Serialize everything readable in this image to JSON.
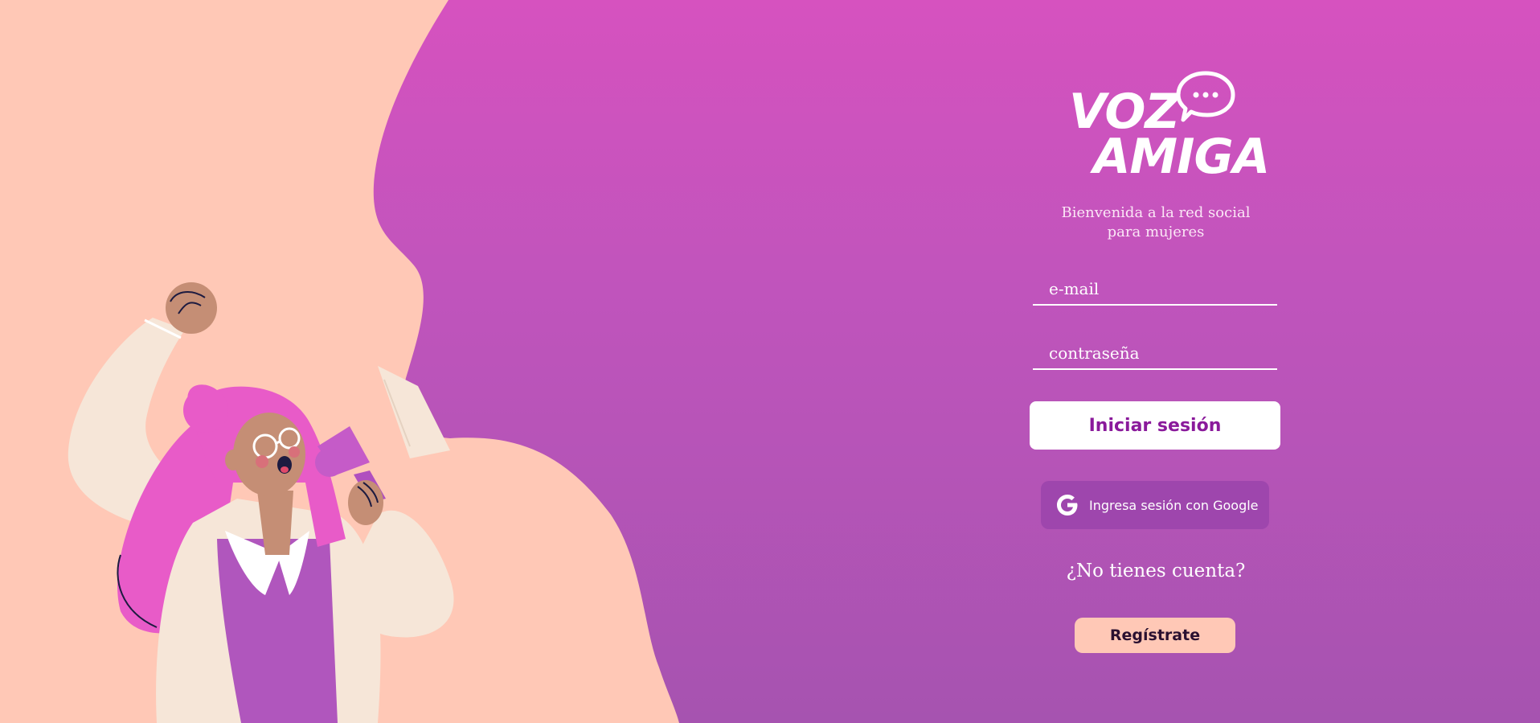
{
  "brand": {
    "logo_line1": "VOZ",
    "logo_line2": "AMIGA",
    "tagline_line1": "Bienvenida a la red social",
    "tagline_line2": "para mujeres"
  },
  "login_form": {
    "email_placeholder": "e-mail",
    "password_placeholder": "contraseña",
    "login_button": "Iniciar sesión",
    "google_button": "Ingresa sesión con Google",
    "no_account_text": "¿No tienes cuenta?",
    "register_button": "Regístrate"
  },
  "icons": {
    "logo_bubble": "speech-bubble-icon",
    "google": "google-icon"
  },
  "colors": {
    "background_top": "#d652bf",
    "background_bottom": "#a653b0",
    "peach": "#ffc8b6",
    "login_text": "#8a1a9b",
    "google_button_bg": "#9e46ad"
  }
}
